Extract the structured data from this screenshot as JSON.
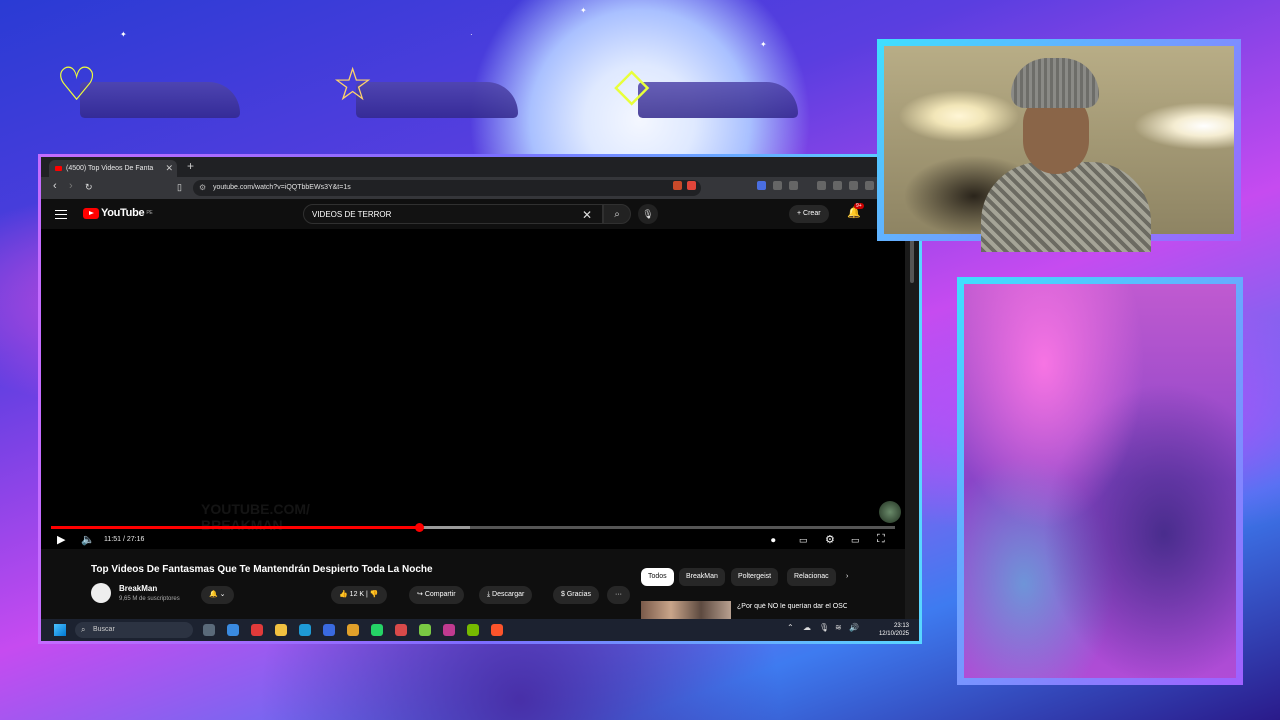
{
  "browser": {
    "tab_title": "(4500) Top Videos De Fanta",
    "tab_close": "✕",
    "new_tab": "+",
    "url": "youtube.com/watch?v=iQQTbbEWs3Y&t=1s",
    "minimize": "—"
  },
  "youtube": {
    "logo": "YouTube",
    "region": "PE",
    "search_value": "VIDEOS DE TERROR",
    "create_label": "Crear",
    "notif_count": "9+",
    "watermark_line1": "YOUTUBE.COM/",
    "watermark_line2": "BREAKMAN",
    "time": "11:51 / 27:16",
    "progress_played": 0.436,
    "progress_buffered": 0.497,
    "video_title": "Top Videos De Fantasmas Que Te Mantendrán Despierto Toda La Noche",
    "channel": "BreakMan",
    "subscribers": "9,65 M de suscriptores",
    "likes": "12 K",
    "share_label": "Compartir",
    "download_label": "Descargar",
    "thanks_label": "Gracias",
    "chips": [
      "Todos",
      "BreakMan",
      "Poltergeist",
      "Relacionac"
    ],
    "rec_title": "¿Por qué NO le querían dar el ÓSCAR a LEONARDO"
  },
  "taskbar": {
    "search_placeholder": "Buscar",
    "time": "23:13",
    "date": "12/10/2025"
  },
  "colors": {
    "yt_red": "#ff0000",
    "frame_accent": "#a060ff"
  }
}
